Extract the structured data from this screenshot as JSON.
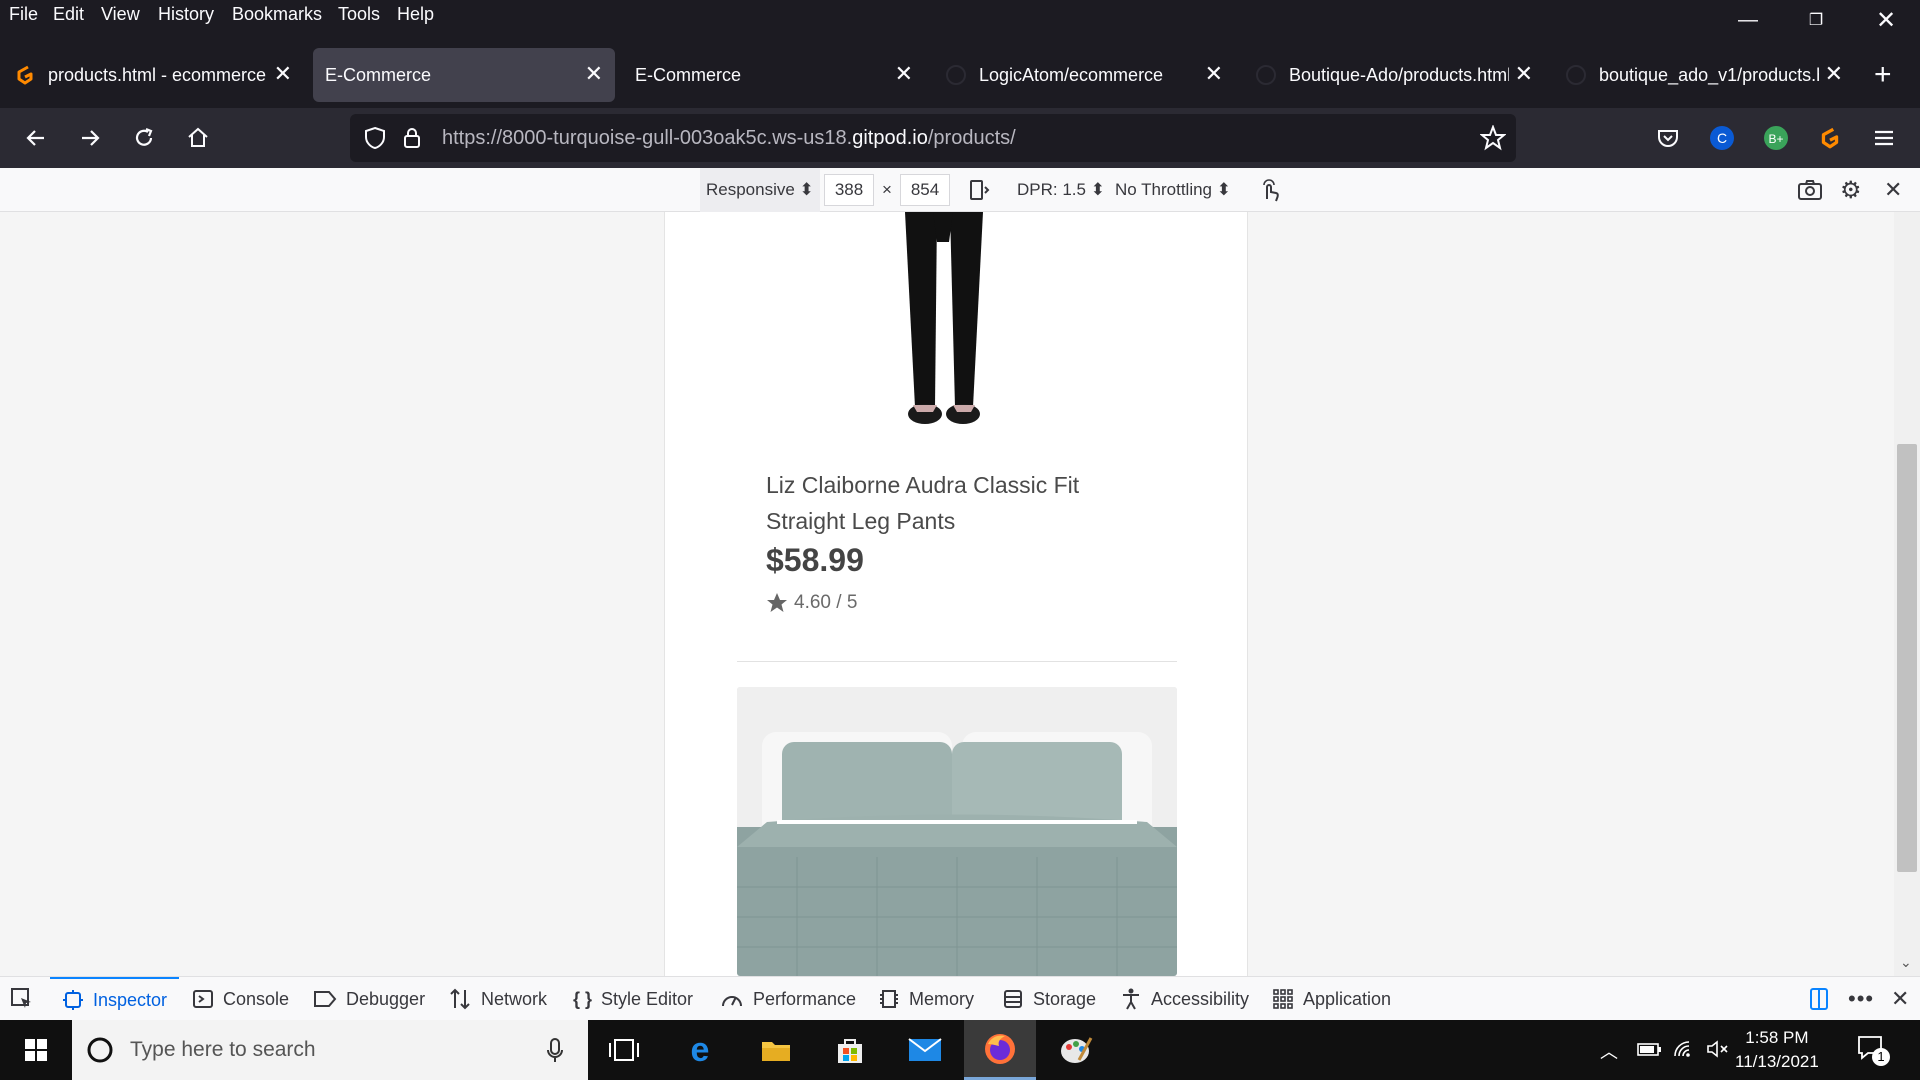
{
  "menu": [
    "File",
    "Edit",
    "View",
    "History",
    "Bookmarks",
    "Tools",
    "Help"
  ],
  "tabs": [
    {
      "title": "products.html - ecommerce",
      "icon": "gitpod-icon"
    },
    {
      "title": "E-Commerce",
      "icon": ""
    },
    {
      "title": "E-Commerce",
      "icon": ""
    },
    {
      "title": "LogicAtom/ecommerce",
      "icon": "github-icon"
    },
    {
      "title": "Boutique-Ado/products.html",
      "icon": "github-icon"
    },
    {
      "title": "boutique_ado_v1/products.h",
      "icon": "github-icon"
    }
  ],
  "url": {
    "prefix": "https://8000-turquoise-gull-003oak5c.ws-us18.",
    "domain": "gitpod.io",
    "suffix": "/products/"
  },
  "rdm": {
    "device": "Responsive",
    "width": "388",
    "height": "854",
    "times": "×",
    "dpr": "DPR: 1.5",
    "throttling": "No Throttling"
  },
  "product": {
    "title": "Liz Claiborne Audra Classic Fit Straight Leg Pants",
    "price": "$58.99",
    "rating": "4.60 / 5"
  },
  "devtools": [
    "Inspector",
    "Console",
    "Debugger",
    "Network",
    "Style Editor",
    "Performance",
    "Memory",
    "Storage",
    "Accessibility",
    "Application"
  ],
  "taskbar": {
    "search_placeholder": "Type here to search",
    "time": "1:58 PM",
    "date": "11/13/2021",
    "notifications": "1"
  },
  "colors": {
    "accent": "#0a84ff",
    "page_bg": "#f5f5f5"
  }
}
